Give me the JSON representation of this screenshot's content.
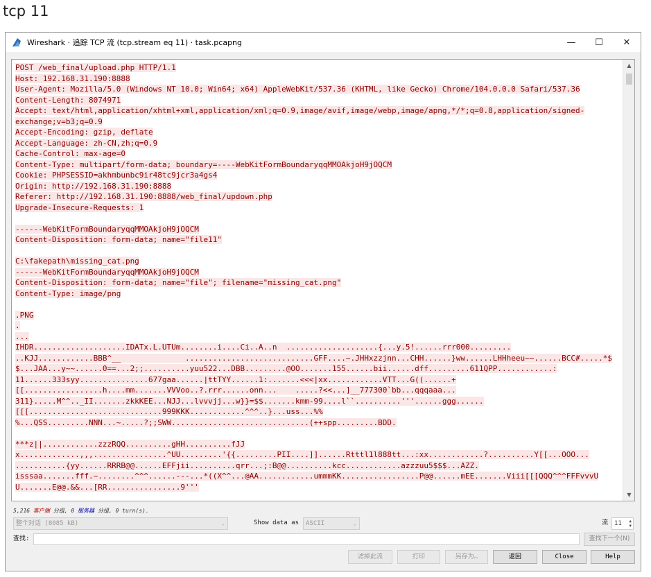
{
  "caption": "tcp 11",
  "window": {
    "title": "Wireshark · 追踪 TCP 流 (tcp.stream eq 11) · task.pcapng",
    "controls": {
      "minimize": "—",
      "maximize": "☐",
      "close": "✕"
    }
  },
  "stream": {
    "lines": [
      "POST /web_final/upload.php HTTP/1.1",
      "Host: 192.168.31.190:8888",
      "User-Agent: Mozilla/5.0 (Windows NT 10.0; Win64; x64) AppleWebKit/537.36 (KHTML, like Gecko) Chrome/104.0.0.0 Safari/537.36",
      "Content-Length: 8074971",
      "Accept: text/html,application/xhtml+xml,application/xml;q=0.9,image/avif,image/webp,image/apng,*/*;q=0.8,application/signed-",
      "exchange;v=b3;q=0.9",
      "Accept-Encoding: gzip, deflate",
      "Accept-Language: zh-CN,zh;q=0.9",
      "Cache-Control: max-age=0",
      "Content-Type: multipart/form-data; boundary=----WebKitFormBoundaryqqMMOAkjoH9jOQCM",
      "Cookie: PHPSESSID=akhmbunbc9ir48tc9jcr3a4gs4",
      "Origin: http://192.168.31.190:8888",
      "Referer: http://192.168.31.190:8888/web_final/updown.php",
      "Upgrade-Insecure-Requests: 1",
      "",
      "------WebKitFormBoundaryqqMMOAkjoH9jOQCM",
      "Content-Disposition: form-data; name=\"file11\"",
      "",
      "C:\\fakepath\\missing_cat.png",
      "------WebKitFormBoundaryqqMMOAkjoH9jOQCM",
      "Content-Disposition: form-data; name=\"file\"; filename=\"missing_cat.png\"",
      "Content-Type: image/png",
      "",
      ".PNG",
      ".",
      "...",
      "IHDR....................IDATx.L.UTUm........i....Ci..A..n  ....................{...y.5!......rrr000.........",
      "..KJJ............BBB^__              ............................GFF....~.JHHxzzjnn...CHH......}ww......LHHheeu~~......BCC#.....*$",
      "$...JAA...y~~......0==...2;;..........yuu522...DBB.........@OO.......155......bii......dff.........611QPP............:",
      "11......333syy...............677gaa......|ttTYY......1:.......<<<|xx............VTT...G((......+",
      "[[.................h....mm.......VVVoo..?.rrr......onn...    .....?<<...]__777300`bb...qqqaaa...",
      "311}.....M^^.._II.......zkkKEE...NJJ...lvvvjj...w}}=$$.......kmm-99....l``..........'''......ggg......",
      "[[[.............................999KKK............^^^..}...uss...%%",
      "%...QSS.........NNN...~.....?;;SWW..............................(++spp.........BDD.",
      "",
      "***z||............zzzRQQ..........gHH..........fJJ",
      "x.............,,,................^UU.........'{{.........PII....]]......Rtttl1l888tt...:xx............?..........Y[[...OOO...",
      "...........{yy......RRRB@@......EFFjii..........qrr...;:B@@..........kcc............azzzuu5$$$...AZZ.",
      "isssaa.......fff.~........^^^......---...*((X^^...@AA............ummmKK.................P@@......mEE.......Viii[[[QQQ^^^FFFvvvU",
      "U.......E@@.&&...[RR................9'''"
    ]
  },
  "stats": {
    "count": "5,216",
    "client_label": "客户端",
    "mid": "分组, 0",
    "server_label": "服务器",
    "tail": "分组, 0 turn(s)."
  },
  "controls": {
    "conversation_select": "整个对话 (8085 kB)",
    "show_data_label": "Show data as",
    "show_data_value": "ASCII",
    "stream_label": "流",
    "stream_value": "11",
    "find_label": "查找:",
    "find_value": "",
    "find_next": "查找下一个(N)"
  },
  "buttons": {
    "filter_out": "滤掉此流",
    "print": "打印",
    "save_as": "另存为…",
    "back": "返回",
    "close": "Close",
    "help": "Help"
  },
  "colors": {
    "client_text": "#8b0000",
    "client_bg": "#fae6e6"
  }
}
